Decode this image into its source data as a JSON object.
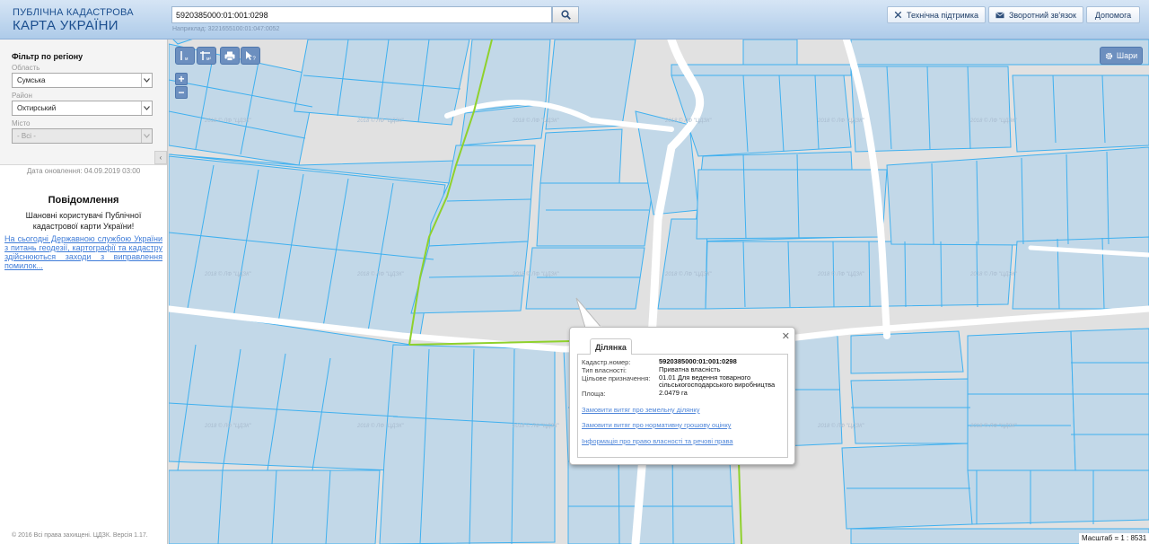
{
  "header": {
    "logo_line1": "ПУБЛІЧНА КАДАСТРОВА",
    "logo_line2": "КАРТА УКРАЇНИ",
    "search_value": "5920385000:01:001:0298",
    "search_example": "Наприклад: 3221655100:01:047:0052",
    "buttons": {
      "support": "Технічна підтримка",
      "feedback": "Зворотний зв'язок",
      "help": "Допомога"
    }
  },
  "sidebar": {
    "filter_title": "Фільтр по регіону",
    "region_label": "Область",
    "region_value": "Сумська",
    "district_label": "Район",
    "district_value": "Охтирський",
    "city_label": "Місто",
    "city_value": "- Всі -",
    "update_date": "Дата оновлення: 04.09.2019 03:00",
    "notice_title": "Повідомлення",
    "notice_text": "Шановні користувачі Публічної кадастрової карти України!",
    "notice_link": "На сьогодні Державною службою України з питань геодезії, картографії та кадастру здійснюються заходи з виправлення помилок...",
    "copyright": "© 2016 Всі права захищені. ЦДЗК. Версія 1.17."
  },
  "map": {
    "layers_label": "Шари",
    "watermark": "2018 © ЛФ \"ЦДЗК\"",
    "scale_label": "Масштаб = 1 : 8531"
  },
  "popup": {
    "tab_label": "Ділянка",
    "rows": [
      {
        "key": "Кадастр.номер:",
        "value": "5920385000:01:001:0298"
      },
      {
        "key": "Тип власності:",
        "value": "Приватна власність"
      },
      {
        "key": "Цільове призначення:",
        "value": "01.01 Для ведення товарного сільськогосподарського виробництва"
      },
      {
        "key": "Площа:",
        "value": "2.0479 га"
      }
    ],
    "links": [
      "Замовити витяг про земельну ділянку",
      "Замовити витяг про нормативну грошову оцінку",
      "Інформація про право власності та речові права"
    ]
  },
  "colors": {
    "parcel_fill": "#c2d8e8",
    "parcel_stroke": "#3fb0ef",
    "boundary_green": "#8fd12c",
    "road_white": "#ffffff",
    "tool_blue": "#6c8fbf"
  }
}
